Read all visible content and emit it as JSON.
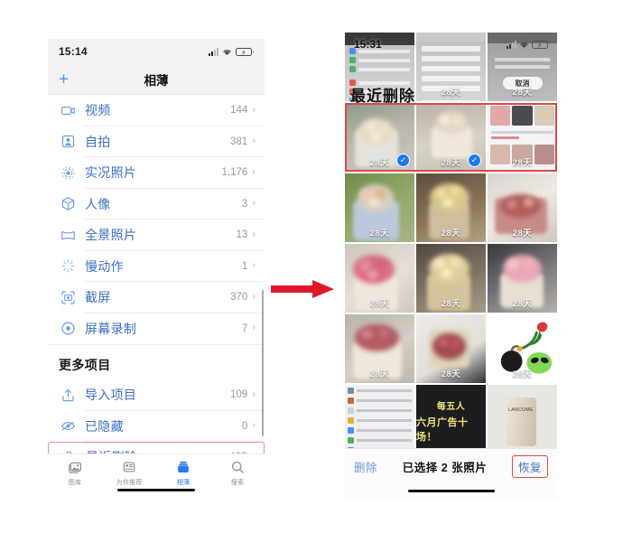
{
  "left_phone": {
    "status_bar": {
      "time": "15:14",
      "signal_icon": "cellular-signal-icon",
      "wifi_icon": "wifi-icon",
      "battery_icon": "battery-low-power-icon"
    },
    "nav": {
      "add_label": "+",
      "title": "相薄"
    },
    "media_types": [
      {
        "icon": "video-camera-icon",
        "label": "视频",
        "count": "144"
      },
      {
        "icon": "portrait-person-icon",
        "label": "自拍",
        "count": "381"
      },
      {
        "icon": "live-photo-icon",
        "label": "实况照片",
        "count": "1,176"
      },
      {
        "icon": "cube-portrait-icon",
        "label": "人像",
        "count": "3"
      },
      {
        "icon": "panorama-icon",
        "label": "全景照片",
        "count": "13"
      },
      {
        "icon": "slow-motion-icon",
        "label": "慢动作",
        "count": "1"
      },
      {
        "icon": "screenshot-icon",
        "label": "截屏",
        "count": "370"
      },
      {
        "icon": "screen-recording-icon",
        "label": "屏幕录制",
        "count": "7"
      }
    ],
    "more_section": {
      "title": "更多项目",
      "items": [
        {
          "icon": "import-icon",
          "label": "导入项目",
          "count": "109",
          "highlighted": false
        },
        {
          "icon": "hidden-eye-icon",
          "label": "已隐藏",
          "count": "0",
          "highlighted": false
        },
        {
          "icon": "trash-icon",
          "label": "最近删除",
          "count": "407",
          "highlighted": true
        }
      ]
    },
    "tabs": [
      {
        "icon": "photos-library-icon",
        "label": "图库",
        "active": false
      },
      {
        "icon": "for-you-icon",
        "label": "为你推荐",
        "active": false
      },
      {
        "icon": "albums-icon",
        "label": "相薄",
        "active": true
      },
      {
        "icon": "search-icon",
        "label": "搜索",
        "active": false
      }
    ],
    "chevron": "›"
  },
  "arrow": {
    "name": "right-arrow",
    "color": "#e0162b"
  },
  "right_phone": {
    "status_bar": {
      "time": "15:31",
      "signal_icon": "cellular-signal-icon",
      "wifi_icon": "wifi-icon",
      "battery_icon": "battery-low-power-icon"
    },
    "title": "最近删除",
    "day_tag": "28天",
    "selection_checkmark": "✓",
    "cells": [
      {
        "kind": "settings-screenshot-1",
        "day_tag": "28天",
        "selected": false
      },
      {
        "kind": "settings-screenshot-2",
        "day_tag": "28天",
        "selected": false
      },
      {
        "kind": "settings-screenshot-3",
        "day_tag": "28天",
        "selected": false,
        "cancel_label": "取消"
      },
      {
        "kind": "bouquet-white-roses",
        "day_tag": "28天",
        "selected": true
      },
      {
        "kind": "bouquet-knit-basket",
        "day_tag": "28天",
        "selected": true
      },
      {
        "kind": "shopping-page",
        "day_tag": "28天",
        "selected": false
      },
      {
        "kind": "bouquet-pastel-mix",
        "day_tag": "28天",
        "selected": false
      },
      {
        "kind": "bouquet-yellow-roses",
        "day_tag": "28天",
        "selected": false
      },
      {
        "kind": "bouquet-red-pink",
        "day_tag": "28天",
        "selected": false
      },
      {
        "kind": "bouquet-pink-peony",
        "day_tag": "28天",
        "selected": false
      },
      {
        "kind": "bouquet-cream-roses",
        "day_tag": "28天",
        "selected": false
      },
      {
        "kind": "bouquet-pink-basket",
        "day_tag": "28天",
        "selected": false
      },
      {
        "kind": "basket-red-roses",
        "day_tag": "28天",
        "selected": false
      },
      {
        "kind": "bouquet-red-held",
        "day_tag": "28天",
        "selected": false
      },
      {
        "kind": "rose-alien-stickers",
        "day_tag": "28天",
        "selected": false
      },
      {
        "kind": "chat-list",
        "day_tag": "",
        "selected": false
      },
      {
        "kind": "dark-promo",
        "day_tag": "",
        "selected": false,
        "promo_main": "每五人",
        "promo_sub": "六月广告十场！"
      },
      {
        "kind": "cosmetic-product",
        "day_tag": "",
        "selected": false,
        "brand": "LANCOME"
      }
    ],
    "bottom_bar": {
      "delete_label": "删除",
      "selection_label": "已选择 2 张照片",
      "recover_label": "恢复"
    }
  }
}
